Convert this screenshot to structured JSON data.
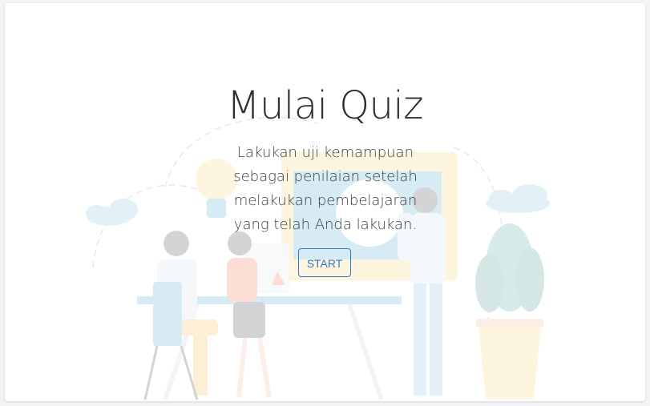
{
  "quiz": {
    "title": "Mulai Quiz",
    "description": "Lakukan uji kemampuan sebagai penilaian setelah melakukan pembelajaran yang telah Anda lakukan.",
    "start_label": "START"
  },
  "colors": {
    "accent": "#2b78d0",
    "title_text": "#2a2f36",
    "card_bg": "#ffffff",
    "page_bg": "#f3f4f5"
  },
  "illustration": {
    "icon": "team-meeting-illustration"
  }
}
